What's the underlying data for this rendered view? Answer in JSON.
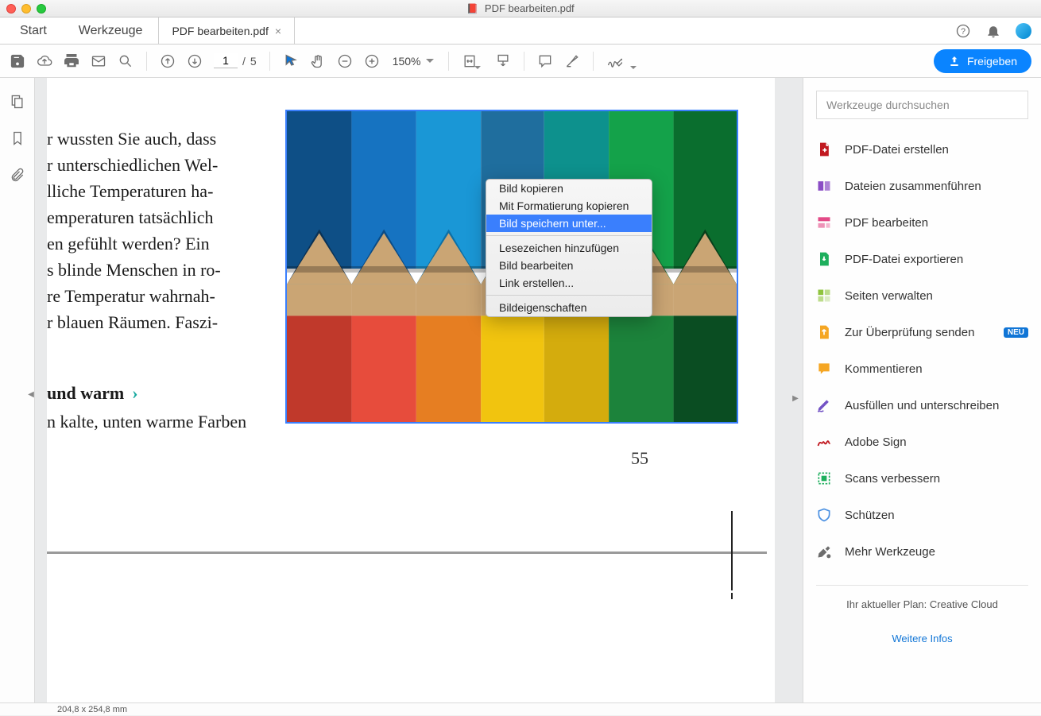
{
  "window": {
    "title": "PDF bearbeiten.pdf"
  },
  "tabs": {
    "home": "Start",
    "tools": "Werkzeuge",
    "doc": "PDF bearbeiten.pdf"
  },
  "toolbar": {
    "page_current": "1",
    "page_sep": "/",
    "page_total": "5",
    "zoom": "150%",
    "share": "Freigeben"
  },
  "document": {
    "paragraph_lines": [
      "r wussten Sie auch, dass",
      "r unterschiedlichen Wel-",
      "lliche Temperaturen ha-",
      "emperaturen tatsächlich",
      "en gefühlt werden? Ein",
      "s blinde Menschen in ro-",
      "re Temperatur wahrnah-",
      "r blauen Räumen. Faszi-"
    ],
    "heading_rest": "und warm",
    "subline": "n kalte, unten warme Farben",
    "page_number": "55"
  },
  "context_menu": {
    "items": [
      {
        "label": "Bild kopieren",
        "sel": false
      },
      {
        "label": "Mit Formatierung kopieren",
        "sel": false
      },
      {
        "label": "Bild speichern unter...",
        "sel": true
      },
      {
        "type": "div"
      },
      {
        "label": "Lesezeichen hinzufügen",
        "sel": false
      },
      {
        "label": "Bild bearbeiten",
        "sel": false
      },
      {
        "label": "Link erstellen...",
        "sel": false
      },
      {
        "type": "div"
      },
      {
        "label": "Bildeigenschaften",
        "sel": false
      }
    ]
  },
  "right_panel": {
    "search_placeholder": "Werkzeuge durchsuchen",
    "items": [
      {
        "label": "PDF-Datei erstellen",
        "icon": "create-pdf",
        "color": "#c11920"
      },
      {
        "label": "Dateien zusammenführen",
        "icon": "combine",
        "color": "#8a4cc5"
      },
      {
        "label": "PDF bearbeiten",
        "icon": "edit-pdf",
        "color": "#e34a87"
      },
      {
        "label": "PDF-Datei exportieren",
        "icon": "export-pdf",
        "color": "#1eaf5d"
      },
      {
        "label": "Seiten verwalten",
        "icon": "organize",
        "color": "#8fc43e"
      },
      {
        "label": "Zur Überprüfung senden",
        "icon": "send-review",
        "color": "#f5a623",
        "badge": "NEU"
      },
      {
        "label": "Kommentieren",
        "icon": "comment",
        "color": "#f5a623"
      },
      {
        "label": "Ausfüllen und unterschreiben",
        "icon": "fill-sign",
        "color": "#7353c5"
      },
      {
        "label": "Adobe Sign",
        "icon": "adobe-sign",
        "color": "#c11920"
      },
      {
        "label": "Scans verbessern",
        "icon": "enhance-scan",
        "color": "#1eaf5d"
      },
      {
        "label": "Schützen",
        "icon": "protect",
        "color": "#4a90e2"
      },
      {
        "label": "Mehr Werkzeuge",
        "icon": "more-tools",
        "color": "#6d6d6d"
      }
    ],
    "plan_line": "Ihr aktueller Plan: Creative Cloud",
    "more_info": "Weitere Infos"
  },
  "statusbar": {
    "dimensions": "204,8 x 254,8 mm"
  }
}
